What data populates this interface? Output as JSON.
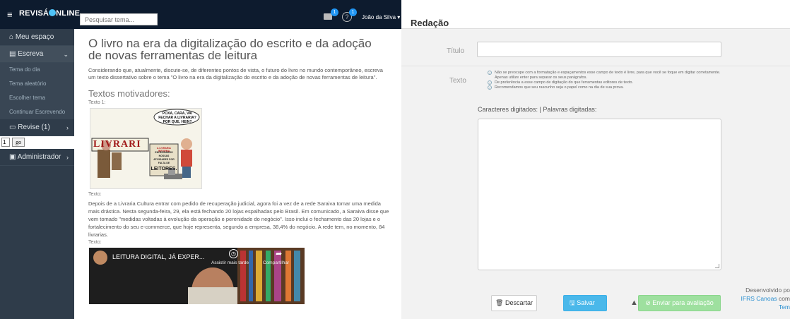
{
  "topbar": {
    "brand": "REVISÁ",
    "brand_suffix": "NLINE",
    "search_placeholder": "Pesquisar tema...",
    "messages_badge": "1",
    "help_badge": "1",
    "user_name": "João da Silva ▾"
  },
  "sidebar": {
    "items": [
      {
        "label": "Meu espaço"
      },
      {
        "label": "Escreva"
      },
      {
        "label": "Revise (1)"
      },
      {
        "label": "Administrador"
      }
    ],
    "subitems": [
      "Tema do dia",
      "Tema aleatório",
      "Escolher tema",
      "Continuar Escrevendo"
    ],
    "pager_value": "1",
    "pager_go": "go"
  },
  "content": {
    "title": "O livro na era da digitalização do escrito e da adoção de novas ferramentas de leitura",
    "intro": "Considerando que, atualmente, discute-se, de diferentes pontos de vista, o futuro do livro no mundo contemporâneo, escreva um texto dissertativo sobre o tema \"O livro na era da digitalização do escrito e da adoção de novas ferramentas de leitura\".",
    "motivational_heading": "Textos motivadores:",
    "text1_label": "Texto 1:",
    "cartoon": {
      "sign": "LIVRARI",
      "bubble": "POXA, CARA, VAI FECHAR A LIVRARIA? POR QUE, HEIN?",
      "poster_top": "A LIVRARIA INFORMA",
      "poster_mid": "ENCERRAMOS NOSSAS ATIVIDADES POR FALTA DE",
      "poster_big": "LEITORES."
    },
    "text2_label": "Texto:",
    "text2": "Depois de a Livraria Cultura entrar com pedido de recuperação judicial, agora foi a vez de a rede Saraiva tomar uma medida mais drástica. Nesta segunda-feira, 29, ela está fechando 20 lojas espalhadas pelo Brasil. Em comunicado, a Saraiva disse que vem tomado \"medidas voltadas à evolução da operação e perenidade do negócio\". Isso inclui o fechamento das 20 lojas e o fortalecimento do seu e-commerce, que hoje representa, segundo a empresa, 38,4% do negócio. A rede tem, no momento, 84 livrarias.",
    "text3_label": "Texto:",
    "video_title": "LEITURA DIGITAL, JÁ EXPER...",
    "video_watch_later": "Assistir mais tarde",
    "video_share": "Compartilhar"
  },
  "form": {
    "heading": "Redação",
    "title_label": "Título",
    "text_label": "Texto",
    "tips": [
      "Não se preocupe com a formatação e espaçamentos esse campo de texto é livre, para que você se foque em digitar corretamente. Apenas utilize enter para separar os seus parágrafos.",
      "De preferência a esse campo de digitação do que ferramentas editores de texto.",
      "Recomendamos que seu rascunho seja o papel como na dia de sua prova."
    ],
    "counter": "Caracteres digitados: | Palavras digitadas:",
    "discard_label": "Descartar",
    "save_label": "Salvar",
    "send_label": "Enviar para avaliação"
  },
  "footer": {
    "line1": "Desenvolvido po",
    "line2_link": "IFRS Canoas",
    "line2_rest": " com",
    "line3": "Tem"
  },
  "colors": {
    "topbar": "#0d1b2e",
    "sidebar": "#2f3c4a",
    "save": "#4ab8ea",
    "send": "#9ee09f"
  }
}
